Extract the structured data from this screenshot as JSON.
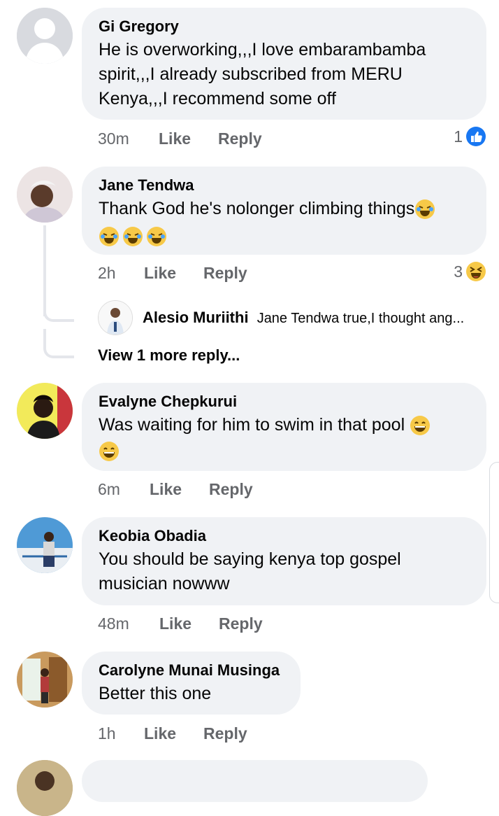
{
  "comments": [
    {
      "name": "Gi Gregory",
      "text_lines": [
        "He is overworking,,,I love embarambamba",
        "spirit,,,I already subscribed from MERU",
        "Kenya,,,I recommend some off"
      ],
      "time": "30m",
      "like": "Like",
      "reply": "Reply",
      "reaction_count": "1"
    },
    {
      "name": "Jane Tendwa",
      "text_lines": [
        "Thank God he's nolonger climbing things"
      ],
      "time": "2h",
      "like": "Like",
      "reply": "Reply",
      "reaction_count": "3"
    },
    {
      "name": "Evalyne Chepkurui",
      "text_lines": [
        "Was waiting for him to swim in that pool"
      ],
      "time": "6m",
      "like": "Like",
      "reply": "Reply"
    },
    {
      "name": "Keobia Obadia",
      "text_lines": [
        "You should be saying kenya top gospel",
        "musician nowww"
      ],
      "time": "48m",
      "like": "Like",
      "reply": "Reply"
    },
    {
      "name": "Carolyne Munai Musinga",
      "text_lines": [
        "Better this one"
      ],
      "time": "1h",
      "like": "Like",
      "reply": "Reply"
    }
  ],
  "reply_preview": {
    "name": "Alesio Muriithi",
    "text": "Jane Tendwa true,I thought ang..."
  },
  "view_more": "View 1 more reply...",
  "colors": {
    "bubble": "#f0f2f5",
    "meta": "#65676b",
    "like_blue": "#1877f2",
    "emoji_yellow": "#f7c948"
  }
}
